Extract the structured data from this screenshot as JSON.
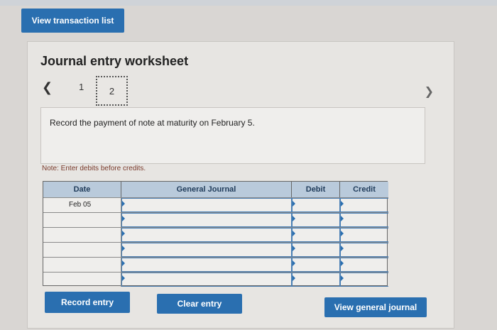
{
  "top": {
    "view_transactions_label": "View transaction list"
  },
  "worksheet": {
    "title": "Journal entry worksheet",
    "pages": [
      "1",
      "2"
    ],
    "instruction": "Record the payment of note at maturity on February 5.",
    "note": "Note: Enter debits before credits.",
    "table": {
      "headers": {
        "date": "Date",
        "journal": "General Journal",
        "debit": "Debit",
        "credit": "Credit"
      },
      "rows": [
        {
          "date": "Feb 05",
          "journal": "",
          "debit": "",
          "credit": ""
        },
        {
          "date": "",
          "journal": "",
          "debit": "",
          "credit": ""
        },
        {
          "date": "",
          "journal": "",
          "debit": "",
          "credit": ""
        },
        {
          "date": "",
          "journal": "",
          "debit": "",
          "credit": ""
        },
        {
          "date": "",
          "journal": "",
          "debit": "",
          "credit": ""
        },
        {
          "date": "",
          "journal": "",
          "debit": "",
          "credit": ""
        }
      ]
    },
    "buttons": {
      "record": "Record entry",
      "clear": "Clear entry",
      "view_journal": "View general journal"
    }
  },
  "colors": {
    "button": "#2a6fb0",
    "header": "#b9cadb",
    "note": "#7a3b2c"
  }
}
